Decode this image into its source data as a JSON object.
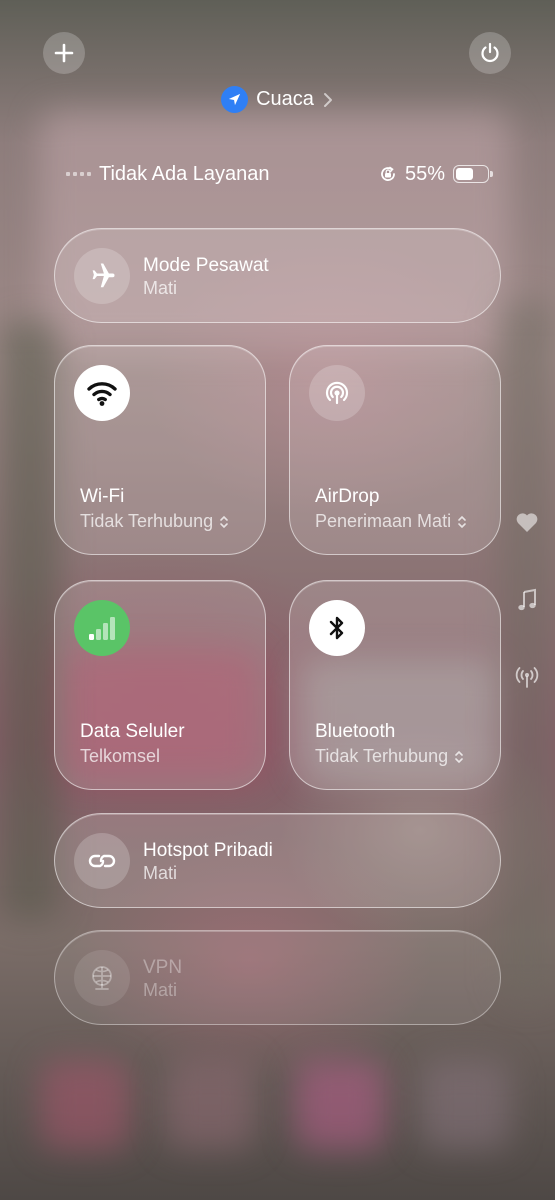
{
  "header": {
    "location_label": "Cuaca"
  },
  "status_bar": {
    "carrier": "Tidak Ada Layanan",
    "battery_percent": "55%",
    "battery_level": 0.55
  },
  "airplane": {
    "title": "Mode Pesawat",
    "status": "Mati"
  },
  "wifi": {
    "title": "Wi-Fi",
    "status": "Tidak Terhubung"
  },
  "airdrop": {
    "title": "AirDrop",
    "status": "Penerimaan Mati"
  },
  "cellular": {
    "title": "Data Seluler",
    "status": "Telkomsel"
  },
  "bluetooth": {
    "title": "Bluetooth",
    "status": "Tidak Terhubung"
  },
  "hotspot": {
    "title": "Hotspot Pribadi",
    "status": "Mati"
  },
  "vpn": {
    "title": "VPN",
    "status": "Mati"
  },
  "icons": [
    "plus-icon",
    "power-icon",
    "location-arrow-icon",
    "chevron-right-icon",
    "orientation-lock-icon",
    "battery-icon",
    "airplane-icon",
    "wifi-icon",
    "airdrop-icon",
    "cellular-icon",
    "bluetooth-icon",
    "hotspot-link-icon",
    "vpn-globe-icon",
    "heart-icon",
    "music-note-icon",
    "antenna-icon"
  ],
  "colors": {
    "location": "#2f7ff5",
    "cellular_on": "#5ac467"
  }
}
